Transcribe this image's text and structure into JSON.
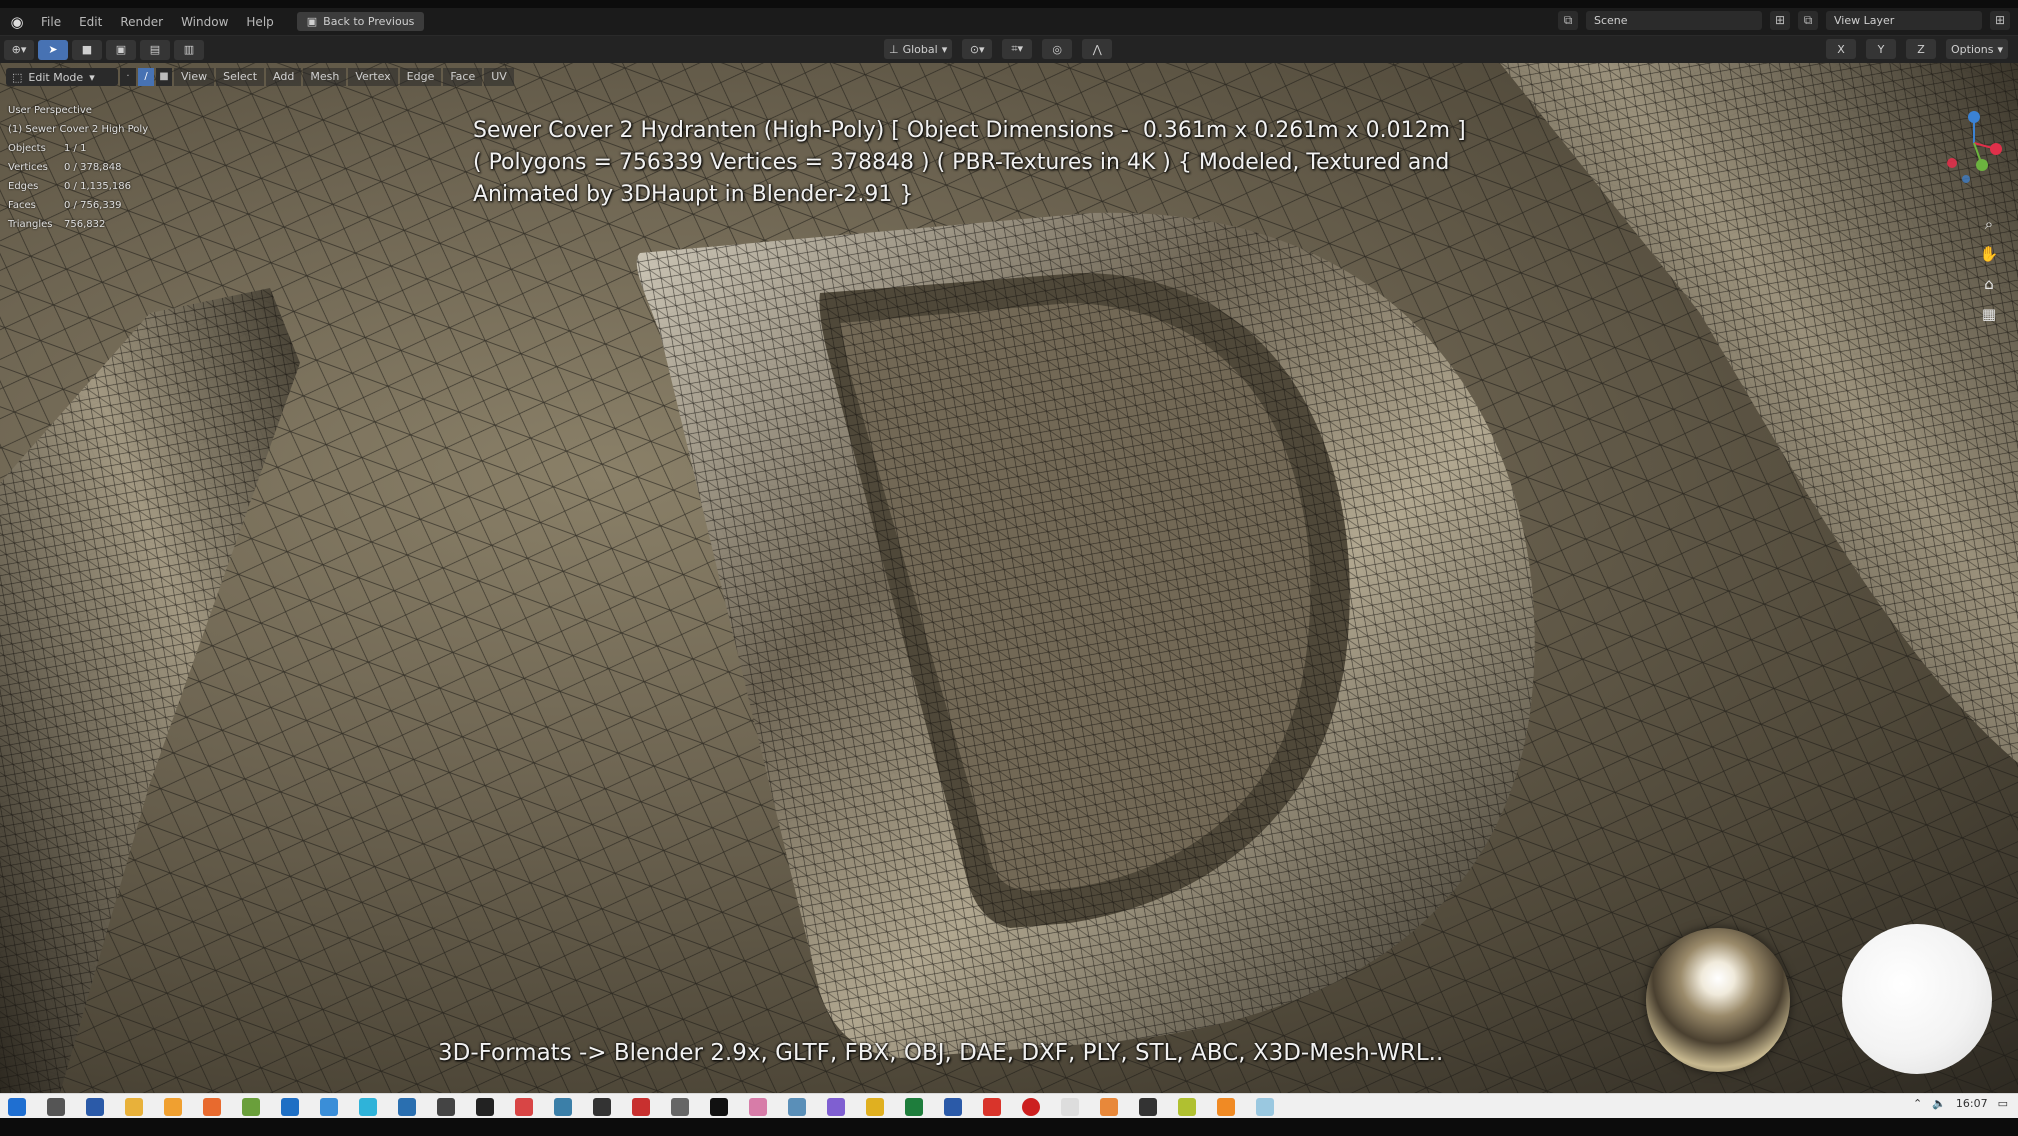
{
  "window": {
    "menu": [
      "File",
      "Edit",
      "Render",
      "Window",
      "Help"
    ],
    "back_button": "Back to Previous",
    "scene_label": "Scene",
    "view_layer_label": "View Layer"
  },
  "toolbar": {
    "orientation": "Global",
    "options_label": "Options"
  },
  "viewport_header": {
    "mode": "Edit Mode",
    "menus": [
      "View",
      "Select",
      "Add",
      "Mesh",
      "Vertex",
      "Edge",
      "Face",
      "UV"
    ]
  },
  "stats": {
    "view_name": "User Perspective",
    "object_name": "(1) Sewer Cover 2 High Poly",
    "rows": [
      {
        "key": "Objects",
        "value": "1 / 1"
      },
      {
        "key": "Vertices",
        "value": "0 / 378,848"
      },
      {
        "key": "Edges",
        "value": "0 / 1,135,186"
      },
      {
        "key": "Faces",
        "value": "0 / 756,339"
      },
      {
        "key": "Triangles",
        "value": "756,832"
      }
    ]
  },
  "caption": "Sewer Cover 2 Hydranten (High-Poly) [ Object Dimensions -  0.361m x 0.261m x 0.012m ]\n( Polygons = 756339 Vertices = 378848 ) ( PBR-Textures in 4K ) { Modeled, Textured and\nAnimated by 3DHaupt in Blender-2.91 }",
  "formats": "3D-Formats -> Blender 2.9x, GLTF, FBX, OBJ, DAE, DXF, PLY, STL, ABC, X3D-Mesh-WRL..",
  "taskbar": {
    "time": "16:07"
  },
  "colors": {
    "accent": "#4772b3",
    "axis_x": "#e0304a",
    "axis_y": "#6cb33f",
    "axis_z": "#3b82d4"
  }
}
